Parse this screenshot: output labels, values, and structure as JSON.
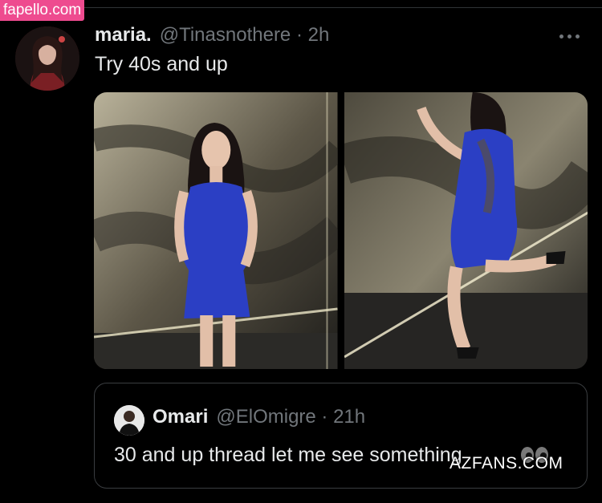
{
  "watermarks": {
    "top": "fapello.com",
    "bottom": "AZFANS.COM"
  },
  "tweet": {
    "display_name": "maria.",
    "meta": "@Tinasnothere · 2h",
    "text": "Try 40s and up",
    "media_count": 2
  },
  "quote": {
    "display_name": "Omari",
    "meta": "@ElOmigre · 21h",
    "text": "30 and up thread let me see something"
  },
  "icons": [
    "more-icon",
    "eyes-icon"
  ],
  "colors": {
    "background": "#000000",
    "text": "#e7e9ea",
    "muted": "#71767b",
    "dress": "#2b3fc4"
  }
}
